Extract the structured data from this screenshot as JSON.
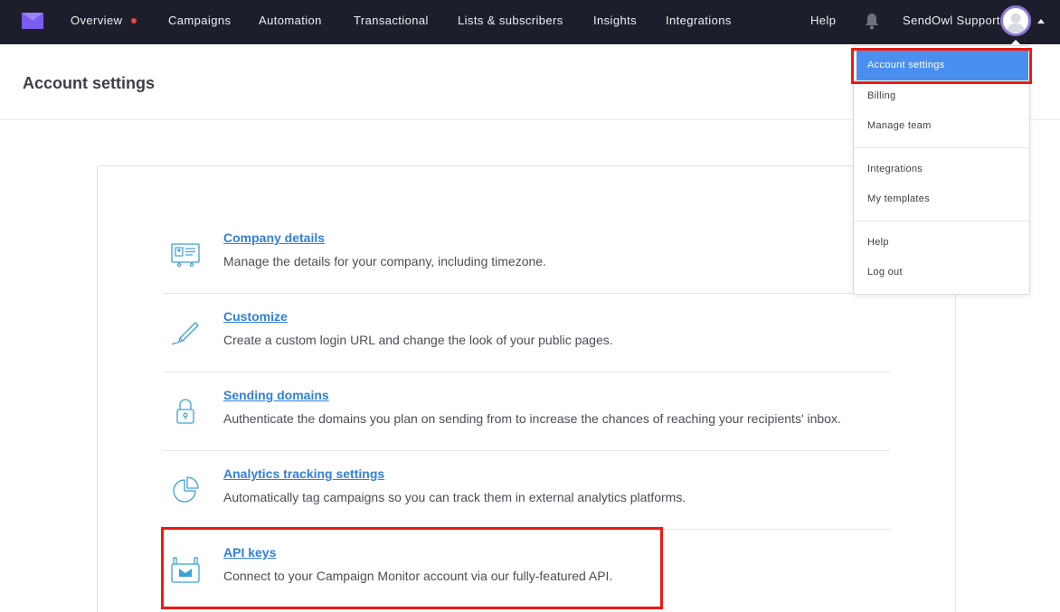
{
  "nav": {
    "items": [
      {
        "label": "Overview",
        "has_dot": true
      },
      {
        "label": "Campaigns"
      },
      {
        "label": "Automation"
      },
      {
        "label": "Transactional"
      },
      {
        "label": "Lists & subscribers"
      },
      {
        "label": "Insights"
      },
      {
        "label": "Integrations"
      }
    ],
    "help": "Help",
    "account_name": "SendOwl Support",
    "notification_dot_color": "#ef4545"
  },
  "page": {
    "title": "Account settings"
  },
  "settings": [
    {
      "title": "Company details",
      "description": "Manage the details for your company, including timezone.",
      "icon": "id-card-icon"
    },
    {
      "title": "Customize",
      "description": "Create a custom login URL and change the look of your public pages.",
      "icon": "pen-icon"
    },
    {
      "title": "Sending domains",
      "description": "Authenticate the domains you plan on sending from to increase the chances of reaching your recipients' inbox.",
      "icon": "lock-icon"
    },
    {
      "title": "Analytics tracking settings",
      "description": "Automatically tag campaigns so you can track them in external analytics platforms.",
      "icon": "pie-chart-icon"
    },
    {
      "title": "API keys",
      "description": "Connect to your Campaign Monitor account via our fully-featured API.",
      "icon": "api-icon"
    }
  ],
  "dropdown": {
    "items": [
      {
        "label": "Account settings",
        "active": true
      },
      {
        "label": "Billing"
      },
      {
        "label": "Manage team"
      },
      {
        "label": "Integrations"
      },
      {
        "label": "My templates"
      },
      {
        "label": "Help"
      },
      {
        "label": "Log out"
      }
    ]
  },
  "colors": {
    "topbar": "#1c1f2b",
    "accent_purple": "#7b5cf0",
    "link_blue": "#2f7fe0",
    "active_item": "#4a8ef0",
    "highlight_red": "#ee1a12",
    "icon_blue": "#3aa0d8"
  }
}
